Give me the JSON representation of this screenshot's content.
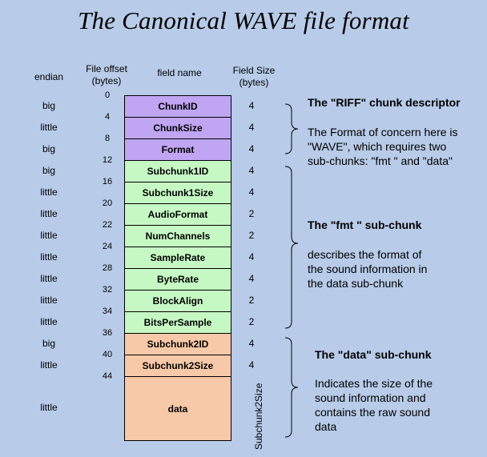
{
  "title": "The Canonical WAVE file format",
  "headers": {
    "endian": "endian",
    "offset_line1": "File offset",
    "offset_line2": "(bytes)",
    "field_name": "field name",
    "size_line1": "Field Size",
    "size_line2": "(bytes)"
  },
  "offsets": [
    "0",
    "4",
    "8",
    "12",
    "16",
    "20",
    "22",
    "24",
    "28",
    "32",
    "34",
    "36",
    "40",
    "44"
  ],
  "fields": [
    {
      "name": "ChunkID",
      "size": "4",
      "endian": "big",
      "chunk": "riff"
    },
    {
      "name": "ChunkSize",
      "size": "4",
      "endian": "little",
      "chunk": "riff"
    },
    {
      "name": "Format",
      "size": "4",
      "endian": "big",
      "chunk": "riff"
    },
    {
      "name": "Subchunk1ID",
      "size": "4",
      "endian": "big",
      "chunk": "fmt"
    },
    {
      "name": "Subchunk1Size",
      "size": "4",
      "endian": "little",
      "chunk": "fmt"
    },
    {
      "name": "AudioFormat",
      "size": "2",
      "endian": "little",
      "chunk": "fmt"
    },
    {
      "name": "NumChannels",
      "size": "2",
      "endian": "little",
      "chunk": "fmt"
    },
    {
      "name": "SampleRate",
      "size": "4",
      "endian": "little",
      "chunk": "fmt"
    },
    {
      "name": "ByteRate",
      "size": "4",
      "endian": "little",
      "chunk": "fmt"
    },
    {
      "name": "BlockAlign",
      "size": "2",
      "endian": "little",
      "chunk": "fmt"
    },
    {
      "name": "BitsPerSample",
      "size": "2",
      "endian": "little",
      "chunk": "fmt"
    },
    {
      "name": "Subchunk2ID",
      "size": "4",
      "endian": "big",
      "chunk": "data"
    },
    {
      "name": "Subchunk2Size",
      "size": "4",
      "endian": "little",
      "chunk": "data"
    },
    {
      "name": "data",
      "size": "Subchunk2Size",
      "endian": "little",
      "chunk": "data"
    }
  ],
  "colors": {
    "riff": "#bfa5f2",
    "fmt": "#c6f8c4",
    "data": "#f8c9a8",
    "background": "#b8cbe8"
  },
  "descriptions": {
    "riff": {
      "title": "The \"RIFF\" chunk descriptor",
      "lines": [
        "The Format of concern here is",
        "\"WAVE\", which requires two",
        "sub-chunks: \"fmt \" and \"data\""
      ]
    },
    "fmt": {
      "title": "The \"fmt \" sub-chunk",
      "lines": [
        "describes the format of",
        "the sound information in",
        "the data sub-chunk"
      ]
    },
    "data": {
      "title": "The \"data\" sub-chunk",
      "lines": [
        "Indicates the size of the",
        "sound information and",
        "contains the raw sound",
        "data"
      ]
    }
  }
}
